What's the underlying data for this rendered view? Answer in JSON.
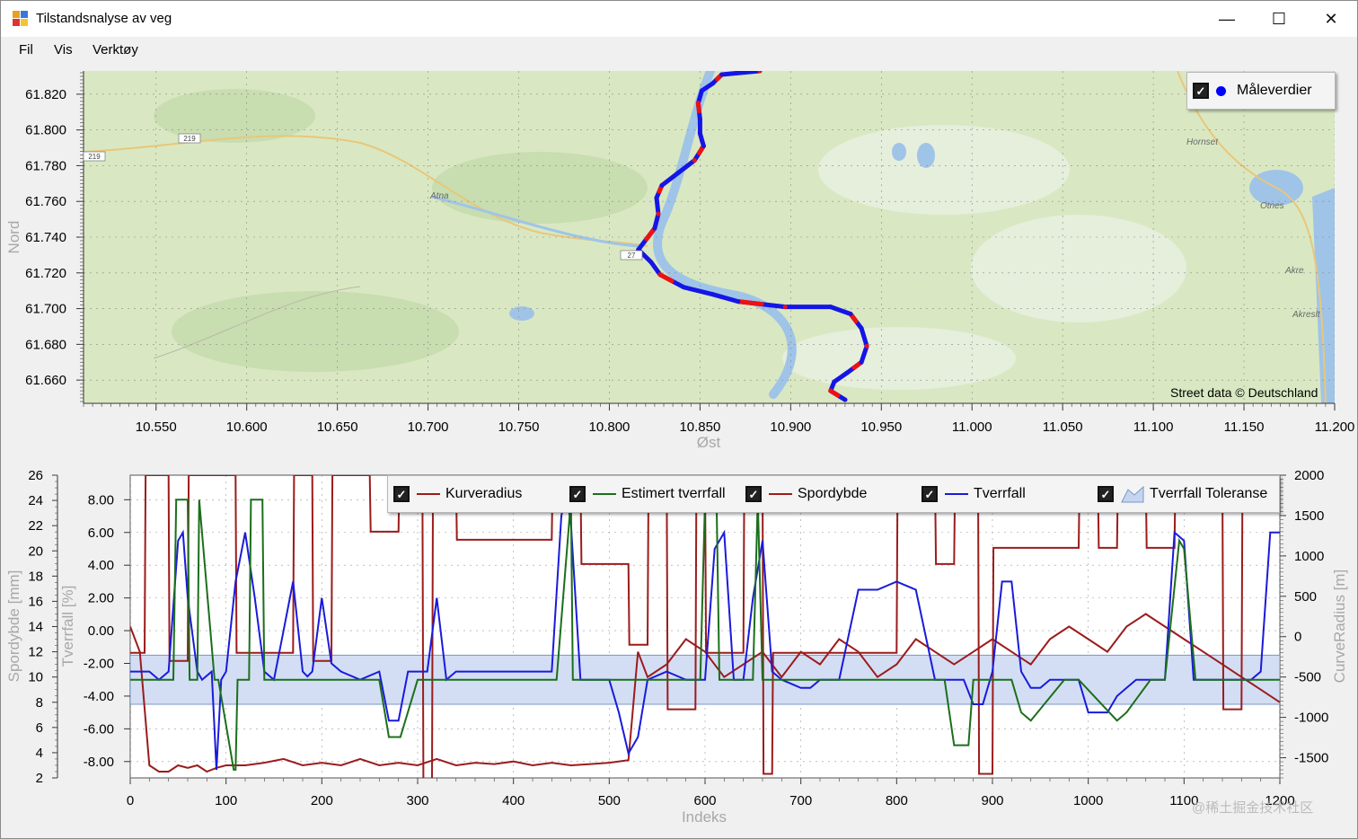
{
  "window": {
    "title": "Tilstandsnalyse av veg",
    "controls": {
      "minimize": "—",
      "maximize": "☐",
      "close": "✕"
    }
  },
  "menu": {
    "items": [
      "Fil",
      "Vis",
      "Verktøy"
    ]
  },
  "map_panel": {
    "legend": {
      "label": "Måleverdier",
      "checked": true,
      "marker_color": "#0000ff"
    },
    "attribution": "Street data © Deutschland",
    "place_labels": [
      "Atna",
      "Hornset",
      "Otnes",
      "Akre",
      "Akreslt"
    ],
    "road_shields": [
      "219",
      "219",
      "27"
    ],
    "chart_data": {
      "type": "line",
      "xlabel": "Øst",
      "ylabel": "Nord",
      "xlim": [
        10.51,
        11.2
      ],
      "ylim": [
        61.647,
        61.833
      ],
      "x_ticks": [
        "10.550",
        "10.600",
        "10.650",
        "10.700",
        "10.750",
        "10.800",
        "10.850",
        "10.900",
        "10.950",
        "11.000",
        "11.050",
        "11.100",
        "11.150",
        "11.200"
      ],
      "y_ticks": [
        "61.820",
        "61.800",
        "61.780",
        "61.760",
        "61.740",
        "61.720",
        "61.700",
        "61.680",
        "61.660"
      ],
      "track_colors": [
        "#1515e6",
        "#ee1111"
      ],
      "track": [
        [
          10.883,
          61.833
        ],
        [
          10.862,
          61.831
        ],
        [
          10.857,
          61.826
        ],
        [
          10.851,
          61.822
        ],
        [
          10.849,
          61.815
        ],
        [
          10.85,
          61.806
        ],
        [
          10.85,
          61.798
        ],
        [
          10.852,
          61.791
        ],
        [
          10.847,
          61.783
        ],
        [
          10.838,
          61.776
        ],
        [
          10.829,
          61.769
        ],
        [
          10.826,
          61.762
        ],
        [
          10.827,
          61.753
        ],
        [
          10.825,
          61.745
        ],
        [
          10.816,
          61.733
        ],
        [
          10.823,
          61.726
        ],
        [
          10.828,
          61.719
        ],
        [
          10.841,
          61.712
        ],
        [
          10.857,
          61.708
        ],
        [
          10.871,
          61.704
        ],
        [
          10.897,
          61.701
        ],
        [
          10.922,
          61.701
        ],
        [
          10.933,
          61.697
        ],
        [
          10.939,
          61.689
        ],
        [
          10.942,
          61.679
        ],
        [
          10.939,
          61.67
        ],
        [
          10.931,
          61.664
        ],
        [
          10.924,
          61.659
        ],
        [
          10.922,
          61.654
        ],
        [
          10.93,
          61.649
        ]
      ]
    }
  },
  "analysis_panel": {
    "legend": {
      "items": [
        {
          "label": "Kurveradius",
          "color": "#9b1c1c",
          "checked": true
        },
        {
          "label": "Estimert tverrfall",
          "color": "#1b6f1b",
          "checked": true
        },
        {
          "label": "Spordybde",
          "color": "#9b1c1c",
          "checked": true
        },
        {
          "label": "Tverrfall",
          "color": "#1a1adc",
          "checked": true
        },
        {
          "label": "Tverrfall Toleranse",
          "color": "#c5d5f0",
          "checked": true
        }
      ]
    },
    "watermark": "@稀土掘金技术社区",
    "chart_data": {
      "type": "line",
      "xlabel": "Indeks",
      "ylabel_left_outer": "Spordybde [mm]",
      "ylabel_left_inner": "Tverrfall [%]",
      "ylabel_right": "CurveRadius [m]",
      "xlim": [
        0,
        1200
      ],
      "x_ticks": [
        "0",
        "100",
        "200",
        "300",
        "400",
        "500",
        "600",
        "700",
        "800",
        "900",
        "1000",
        "1100",
        "1200"
      ],
      "spordybde_ticks": [
        "26",
        "24",
        "22",
        "20",
        "18",
        "16",
        "14",
        "12",
        "10",
        "8",
        "6",
        "4",
        "2"
      ],
      "spordybde_range": [
        2,
        26
      ],
      "tverrfall_ticks": [
        "8.00",
        "6.00",
        "4.00",
        "2.00",
        "0.00",
        "-2.00",
        "-4.00",
        "-6.00",
        "-8.00"
      ],
      "tverrfall_range": [
        -9,
        9.5
      ],
      "radius_ticks": [
        "2000",
        "1500",
        "1000",
        "500",
        "0",
        "-500",
        "-1000",
        "-1500"
      ],
      "radius_range": [
        -1750,
        2000
      ],
      "series": [
        {
          "name": "Tverrfall Toleranse",
          "axis": "tverrfall",
          "band": true,
          "x": [
            0,
            60,
            95,
            100,
            170,
            205,
            230,
            260,
            315,
            320,
            420,
            470,
            495,
            520,
            530,
            560,
            640,
            660,
            700,
            800,
            840,
            860,
            880,
            925,
            990,
            1080,
            1090,
            1120,
            1200
          ],
          "lower": [
            -4.5,
            -4.5,
            -4.5,
            -4.5,
            -4.5,
            -4.5,
            -4.5,
            -4.5,
            -4.5,
            -4.5,
            -4.5,
            -4.5,
            -4.5,
            -4.5,
            -4.5,
            -4.5,
            -4.5,
            -4.5,
            -4.5,
            -4.5,
            -4.5,
            -4.5,
            -4.5,
            -4.5,
            -4.5,
            -4.5,
            -4.5,
            -4.5,
            -4.5
          ],
          "upper": [
            -1.5,
            -1.5,
            -1.5,
            -1.5,
            -1.5,
            -1.5,
            -1.5,
            -1.5,
            -1.5,
            -1.5,
            -1.5,
            -1.5,
            -1.5,
            -1.5,
            -1.5,
            -1.5,
            -1.5,
            -1.5,
            -1.5,
            -1.5,
            -1.5,
            -1.5,
            -1.5,
            -1.5,
            -1.5,
            -1.5,
            -1.5,
            -1.5,
            -1.5
          ]
        },
        {
          "name": "Estimert tverrfall",
          "axis": "tverrfall",
          "x": [
            0,
            45,
            48,
            60,
            62,
            70,
            72,
            88,
            90,
            92,
            108,
            110,
            112,
            124,
            126,
            138,
            140,
            170,
            200,
            225,
            260,
            270,
            282,
            300,
            315,
            320,
            330,
            440,
            445,
            460,
            462,
            520,
            525,
            575,
            585,
            595,
            600,
            612,
            615,
            640,
            650,
            655,
            660,
            665,
            700,
            780,
            850,
            860,
            875,
            880,
            920,
            930,
            940,
            975,
            990,
            1030,
            1040,
            1065,
            1080,
            1095,
            1100,
            1112,
            1118,
            1150,
            1175,
            1180,
            1200
          ],
          "y": [
            -3.0,
            -3.0,
            8.0,
            8.0,
            -3.0,
            -3.0,
            8.0,
            -3.0,
            -3.0,
            -3.0,
            -8.5,
            -8.5,
            -3.0,
            -3.0,
            8.0,
            8.0,
            -3.0,
            -3.0,
            -3.0,
            -3.0,
            -3.0,
            -6.5,
            -6.5,
            -3.0,
            -3.0,
            -3.0,
            -3.0,
            -3.0,
            -3.0,
            8.0,
            -3.0,
            -3.0,
            -3.0,
            -3.0,
            -3.0,
            -3.0,
            8.0,
            8.0,
            -3.0,
            -3.0,
            -3.0,
            8.0,
            -3.0,
            -3.0,
            -3.0,
            -3.0,
            -3.0,
            -7.0,
            -7.0,
            -3.0,
            -3.0,
            -5.0,
            -5.5,
            -3.0,
            -3.0,
            -5.5,
            -5.0,
            -3.0,
            -3.0,
            5.5,
            5.0,
            -3.0,
            -3.0,
            -3.0,
            -3.0,
            -3.0,
            -3.0
          ]
        },
        {
          "name": "Tverrfall",
          "axis": "tverrfall",
          "x": [
            0,
            10,
            20,
            30,
            40,
            50,
            55,
            60,
            70,
            75,
            85,
            90,
            95,
            100,
            110,
            120,
            130,
            140,
            150,
            160,
            170,
            180,
            185,
            190,
            200,
            210,
            220,
            240,
            260,
            270,
            280,
            290,
            300,
            310,
            320,
            330,
            340,
            360,
            380,
            400,
            420,
            440,
            450,
            455,
            460,
            470,
            480,
            500,
            510,
            520,
            530,
            540,
            560,
            580,
            600,
            610,
            620,
            630,
            640,
            650,
            660,
            670,
            680,
            700,
            710,
            720,
            740,
            760,
            780,
            800,
            820,
            840,
            860,
            870,
            880,
            890,
            900,
            910,
            920,
            930,
            940,
            950,
            960,
            970,
            980,
            990,
            1000,
            1010,
            1020,
            1030,
            1040,
            1050,
            1060,
            1070,
            1080,
            1090,
            1100,
            1110,
            1120,
            1130,
            1140,
            1150,
            1160,
            1170,
            1180,
            1190,
            1200
          ],
          "y": [
            -2.5,
            -2.5,
            -2.5,
            -3.0,
            -2.5,
            5.5,
            6.0,
            2.0,
            -2.5,
            -3.0,
            -2.5,
            -8.5,
            -3.0,
            -2.5,
            3.0,
            6.0,
            2.0,
            -2.5,
            -3.0,
            0.0,
            3.0,
            -2.5,
            -2.8,
            -2.5,
            2.0,
            -2.0,
            -2.5,
            -3.0,
            -2.5,
            -5.5,
            -5.5,
            -2.5,
            -2.5,
            -2.5,
            2.0,
            -3.0,
            -2.5,
            -2.5,
            -2.5,
            -2.5,
            -2.5,
            -2.5,
            7.0,
            8.5,
            6.5,
            -3.0,
            -3.0,
            -3.0,
            -5.0,
            -7.5,
            -6.5,
            -3.0,
            -2.5,
            -3.0,
            -3.0,
            5.0,
            6.0,
            -3.0,
            -3.0,
            2.0,
            5.5,
            -2.5,
            -3.0,
            -3.5,
            -3.5,
            -3.0,
            -3.0,
            2.5,
            2.5,
            3.0,
            2.5,
            -3.0,
            -3.0,
            -3.0,
            -4.5,
            -4.5,
            -2.5,
            3.0,
            3.0,
            -2.5,
            -3.5,
            -3.5,
            -3.0,
            -3.0,
            -3.0,
            -3.0,
            -5.0,
            -5.0,
            -5.0,
            -4.0,
            -3.5,
            -3.0,
            -3.0,
            -3.0,
            -3.0,
            6.0,
            5.5,
            -3.0,
            -3.0,
            -3.0,
            -3.0,
            -3.0,
            -3.0,
            -3.0,
            -2.5,
            6.0,
            6.0
          ]
        },
        {
          "name": "Spordybde",
          "axis": "spordybde",
          "x": [
            0,
            10,
            20,
            30,
            40,
            50,
            60,
            70,
            80,
            90,
            100,
            120,
            140,
            160,
            180,
            200,
            220,
            240,
            260,
            280,
            300,
            320,
            340,
            360,
            380,
            400,
            420,
            440,
            460,
            480,
            500,
            520,
            530,
            540,
            560,
            580,
            600,
            620,
            640,
            660,
            680,
            700,
            720,
            740,
            760,
            780,
            800,
            820,
            840,
            860,
            880,
            900,
            920,
            940,
            960,
            980,
            1000,
            1020,
            1040,
            1060,
            1080,
            1100,
            1120,
            1140,
            1160,
            1180,
            1200
          ],
          "y": [
            14,
            12,
            3,
            2.5,
            2.5,
            3,
            2.8,
            3,
            2.5,
            2.8,
            3,
            3,
            3.2,
            3.5,
            3,
            3.2,
            3,
            3.5,
            3,
            3.2,
            3,
            3.5,
            3,
            3.2,
            3.1,
            3.3,
            3,
            3.2,
            3,
            3.1,
            3.2,
            3.4,
            12,
            10,
            11,
            13,
            12,
            10,
            11,
            12,
            10,
            12,
            11,
            13,
            12,
            10,
            11,
            13,
            12,
            11,
            12,
            13,
            12,
            11,
            13,
            14,
            13,
            12,
            14,
            15,
            14,
            13,
            12,
            11,
            10,
            9,
            8
          ]
        },
        {
          "name": "Kurveradius",
          "axis": "radius",
          "x": [
            0,
            15,
            16,
            40,
            41,
            60,
            61,
            110,
            111,
            170,
            171,
            190,
            191,
            210,
            211,
            250,
            251,
            280,
            281,
            305,
            306,
            315,
            316,
            340,
            341,
            440,
            441,
            470,
            471,
            520,
            521,
            540,
            541,
            560,
            561,
            590,
            591,
            600,
            601,
            640,
            641,
            660,
            661,
            670,
            671,
            800,
            801,
            840,
            841,
            860,
            861,
            885,
            886,
            900,
            901,
            990,
            991,
            1010,
            1011,
            1030,
            1031,
            1060,
            1061,
            1090,
            1091,
            1140,
            1141,
            1160,
            1161,
            1200
          ],
          "y": [
            -200,
            -200,
            2000,
            2000,
            -300,
            -300,
            2000,
            2000,
            -200,
            -200,
            2000,
            2000,
            -300,
            -300,
            2000,
            2000,
            1300,
            1300,
            2000,
            2000,
            -1800,
            -1800,
            2000,
            2000,
            1200,
            1200,
            2000,
            2000,
            900,
            900,
            -100,
            -100,
            2000,
            2000,
            -900,
            -900,
            2000,
            2000,
            -200,
            -200,
            2000,
            2000,
            -1700,
            -1700,
            -200,
            -200,
            2000,
            2000,
            900,
            900,
            2000,
            2000,
            -1700,
            -1700,
            1100,
            1100,
            2000,
            2000,
            1100,
            1100,
            2000,
            2000,
            1100,
            1100,
            2000,
            2000,
            -900,
            -900,
            2000,
            2000
          ]
        }
      ]
    }
  }
}
